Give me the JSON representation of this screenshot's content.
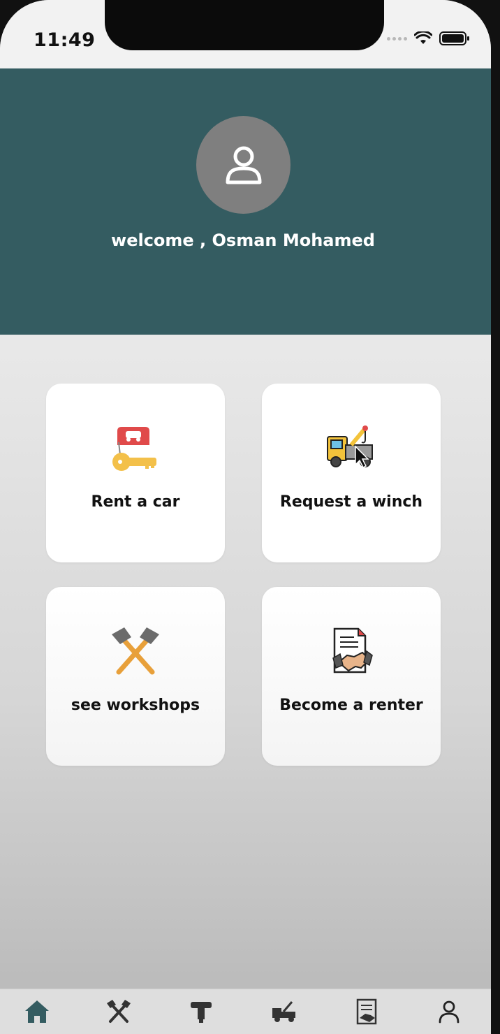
{
  "status_bar": {
    "time": "11:49"
  },
  "header": {
    "welcome_text": "welcome , Osman Mohamed",
    "background_color": "#345c61",
    "avatar_icon": "user-icon"
  },
  "tiles": [
    {
      "label": "Rent a car",
      "icon": "car-key-icon"
    },
    {
      "label": "Request a winch",
      "icon": "tow-truck-icon"
    },
    {
      "label": "see workshops",
      "icon": "hammers-icon"
    },
    {
      "label": "Become a renter",
      "icon": "contract-handshake-icon"
    }
  ],
  "tabbar": {
    "items": [
      {
        "icon": "home-icon",
        "active": true
      },
      {
        "icon": "tools-icon",
        "active": false
      },
      {
        "icon": "spare-part-icon",
        "active": false
      },
      {
        "icon": "tow-truck-icon",
        "active": false
      },
      {
        "icon": "document-icon",
        "active": false
      },
      {
        "icon": "profile-icon",
        "active": false
      }
    ],
    "active_color": "#345c61"
  }
}
